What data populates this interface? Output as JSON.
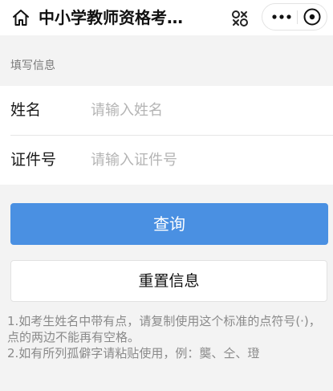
{
  "header": {
    "title": "中小学教师资格考…",
    "icons": {
      "home": "home-icon",
      "scan": "scan-icon",
      "more": "more-dots-icon",
      "close": "close-circle-icon"
    }
  },
  "form": {
    "section_label": "填写信息",
    "name": {
      "label": "姓名",
      "placeholder": "请输入姓名",
      "value": ""
    },
    "id_number": {
      "label": "证件号",
      "placeholder": "请输入证件号",
      "value": ""
    }
  },
  "actions": {
    "query_label": "查询",
    "reset_label": "重置信息"
  },
  "notes": [
    "1.如考生姓名中带有点，请复制使用这个标准的点符号(·)，点的两边不能再有空格。",
    "2.如有所列孤僻字请粘贴使用，例：龑、仝、璒"
  ],
  "colors": {
    "primary": "#4a90e2",
    "background": "#f3f3f3",
    "placeholder": "#b4b4b4",
    "note_text": "#8a8a8a"
  }
}
